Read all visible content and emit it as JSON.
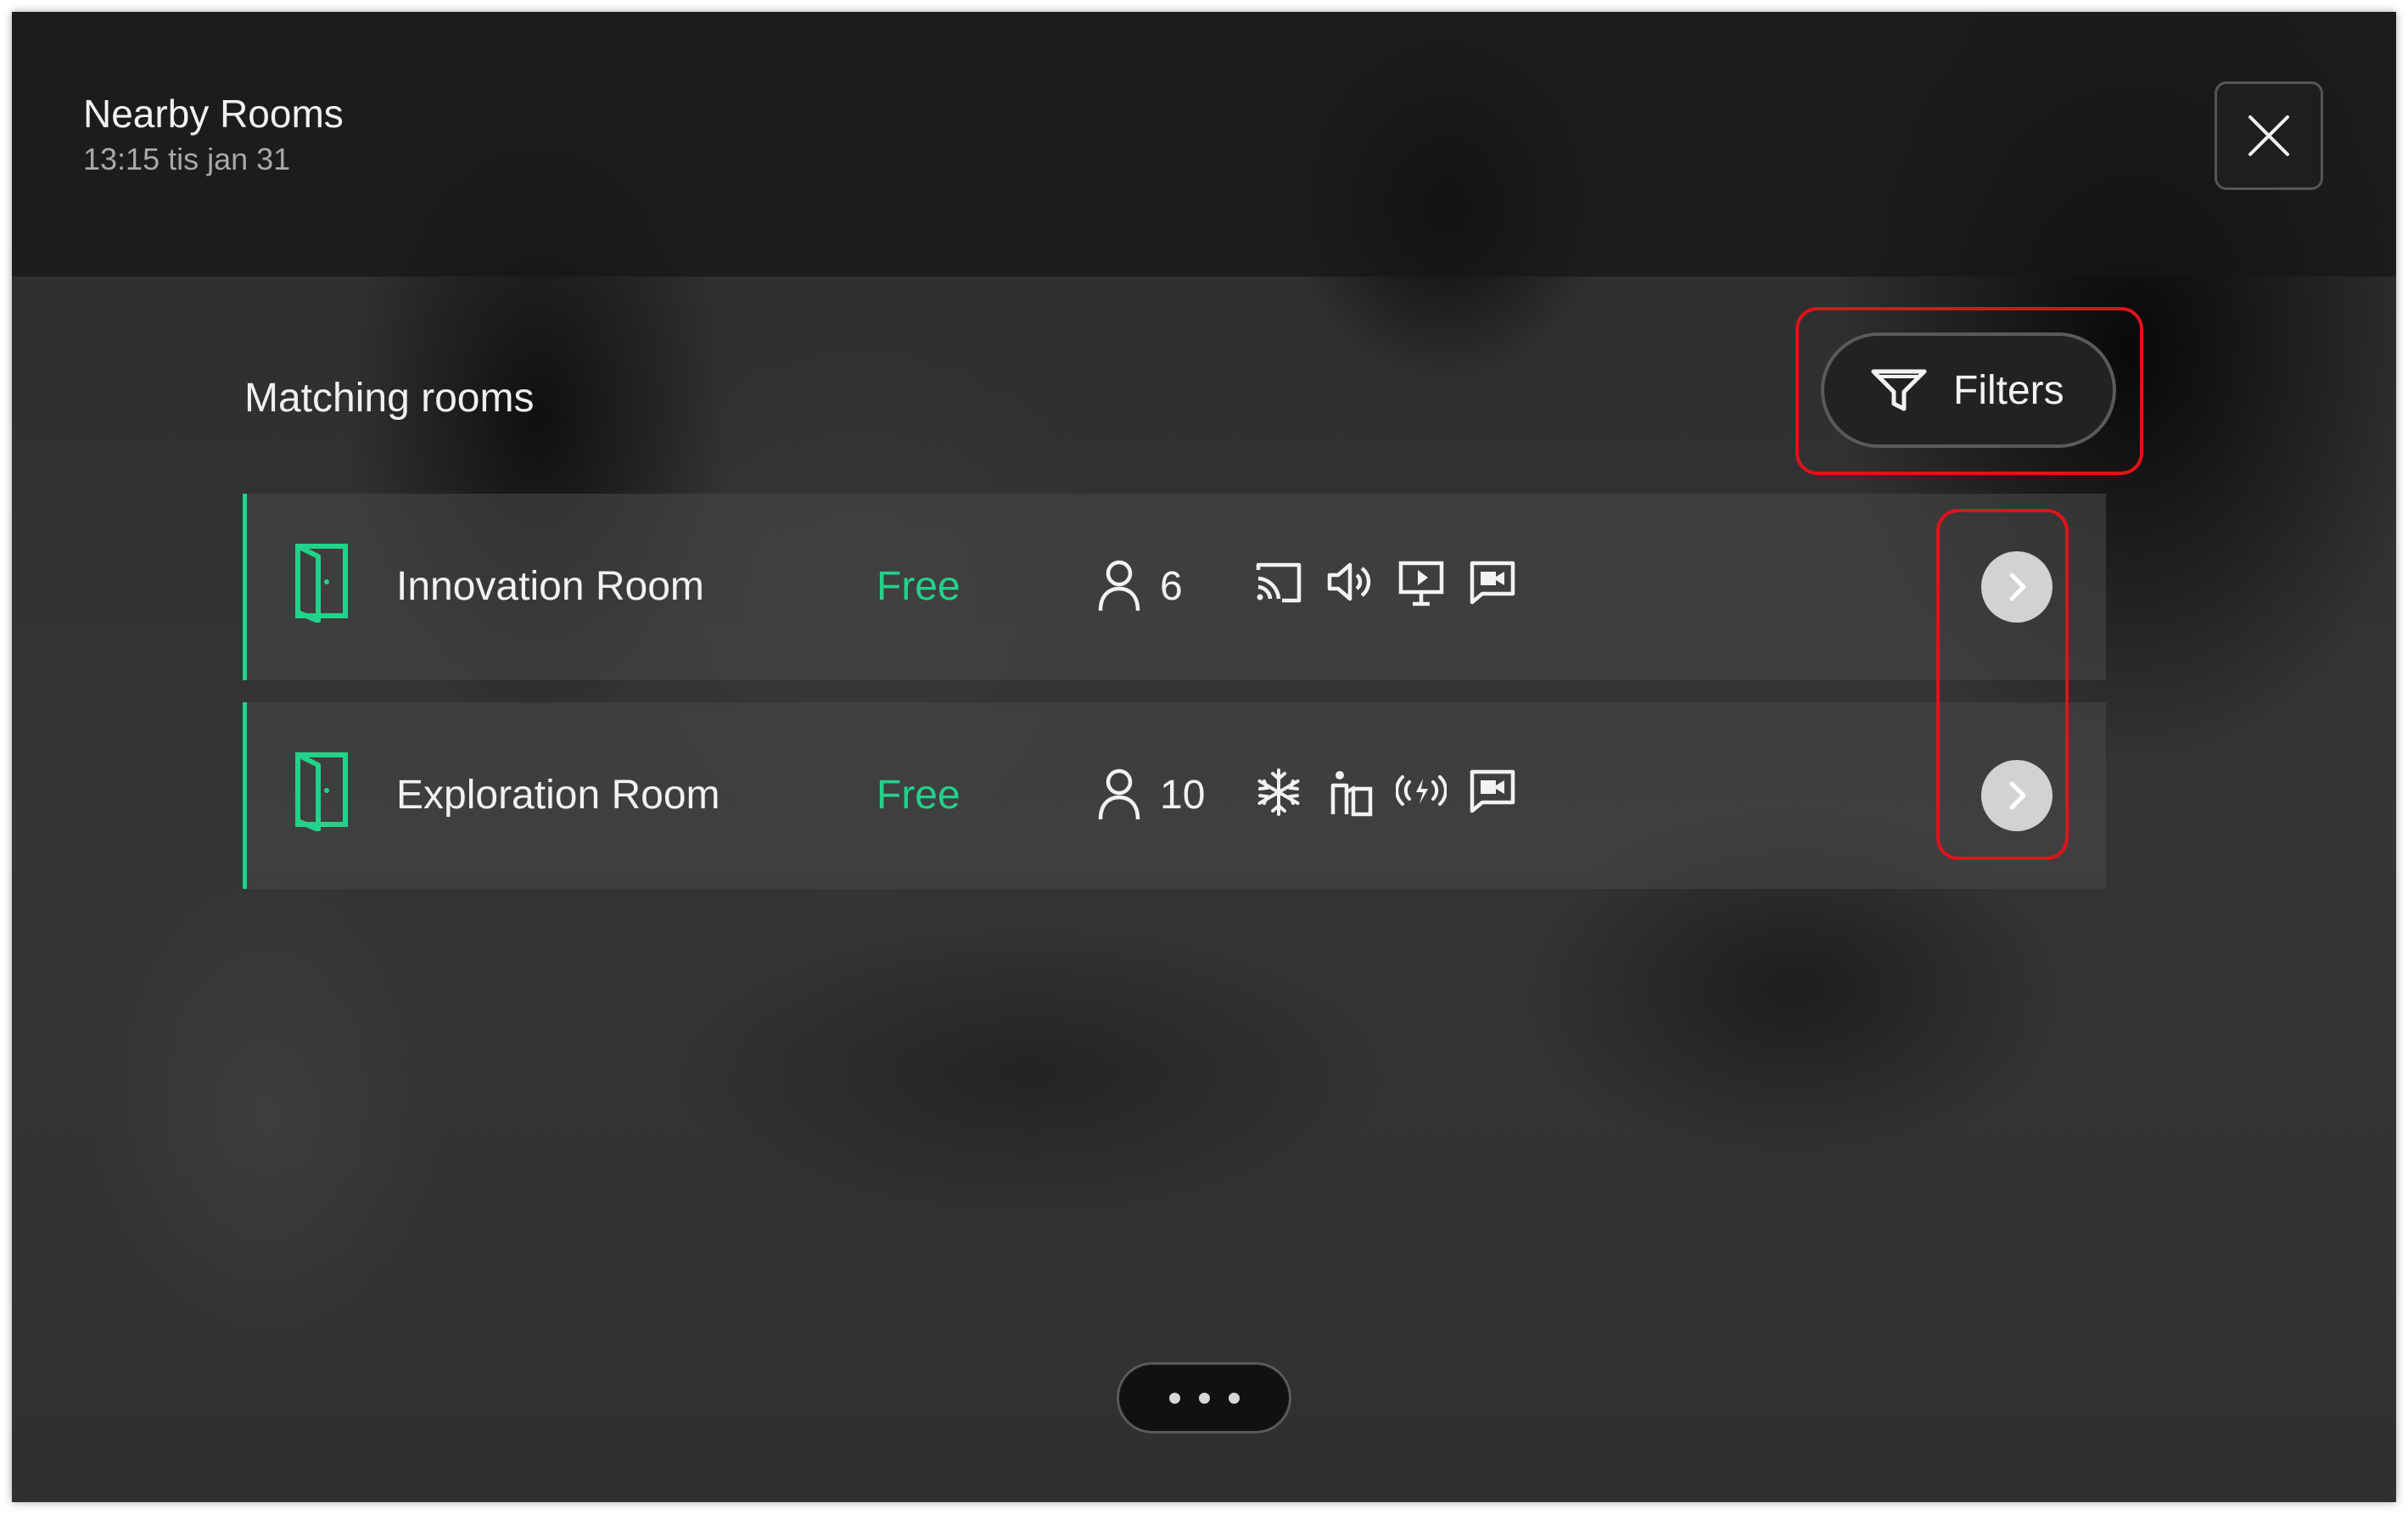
{
  "header": {
    "title": "Nearby Rooms",
    "subtitle": "13:15 tis jan 31",
    "close_icon": "close-icon"
  },
  "main": {
    "heading": "Matching rooms",
    "filters_label": "Filters",
    "filters_icon": "filter-funnel-icon"
  },
  "rooms": [
    {
      "name": "Innovation Room",
      "status": "Free",
      "capacity": "6",
      "features": [
        "cast-icon",
        "speaker-icon",
        "presentation-screen-icon",
        "video-chat-icon"
      ]
    },
    {
      "name": "Exploration Room",
      "status": "Free",
      "capacity": "10",
      "features": [
        "air-conditioning-snowflake-icon",
        "whiteboard-presenter-icon",
        "wireless-signal-icon",
        "video-chat-icon"
      ]
    }
  ],
  "pager": {
    "dots": 3
  },
  "colors": {
    "accent": "#23d18b",
    "highlight": "#e0121b",
    "text": "#f2f2f2",
    "subtext": "#a9a9a9"
  }
}
